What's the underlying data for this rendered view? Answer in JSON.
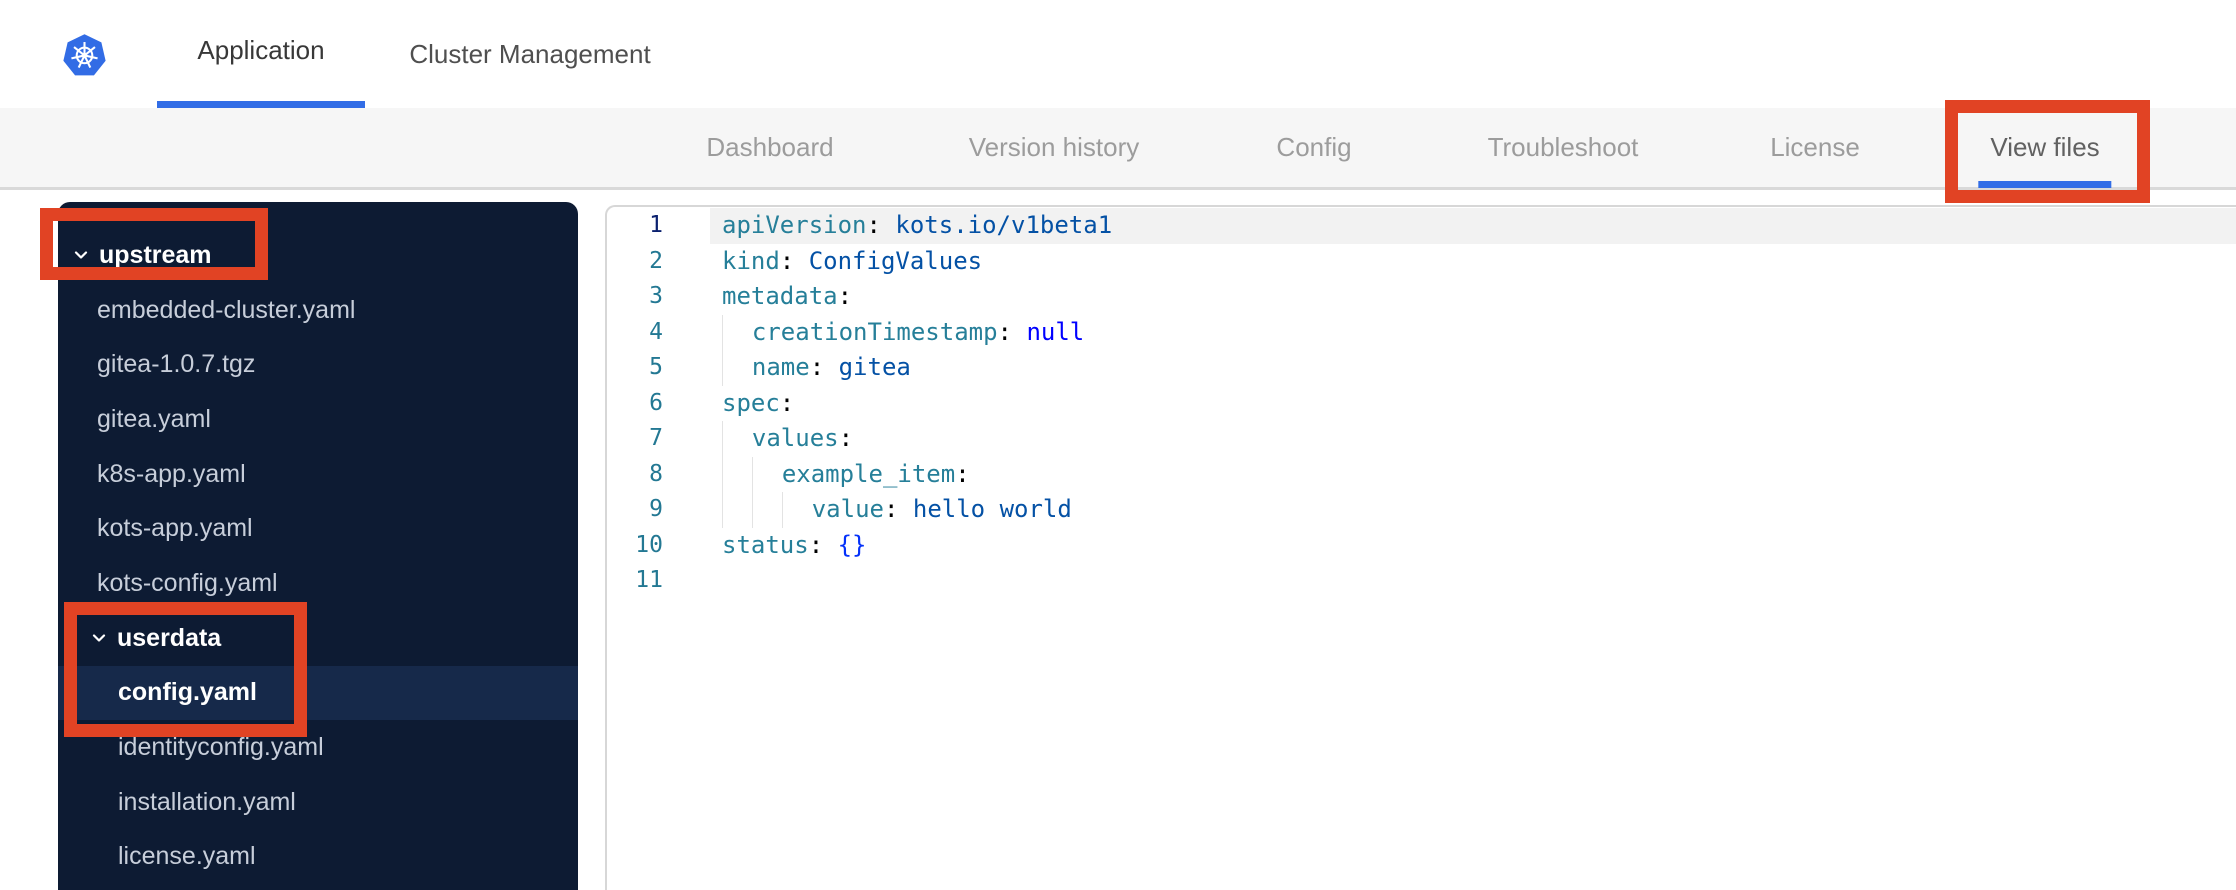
{
  "colors": {
    "accent": "#326DE6",
    "sidebar_bg": "#0D1B33",
    "selected_bg": "#16294A",
    "file_color": "#C7CEDA",
    "line_number": "#237893",
    "line_number_active": "#0B216F",
    "token_key": "#267F99",
    "token_string": "#0451A5",
    "token_keyword": "#0000FF",
    "token_bracket": "#0431FA",
    "annotation_red": "#E14324",
    "logo_blue": "#326CE5"
  },
  "header": {
    "tabs": [
      {
        "label": "Application",
        "active": true
      },
      {
        "label": "Cluster Management",
        "active": false
      }
    ]
  },
  "subnav": {
    "items": [
      {
        "label": "Dashboard",
        "active": false
      },
      {
        "label": "Version history",
        "active": false
      },
      {
        "label": "Config",
        "active": false
      },
      {
        "label": "Troubleshoot",
        "active": false
      },
      {
        "label": "License",
        "active": false
      },
      {
        "label": "View files",
        "active": true
      }
    ]
  },
  "file_tree": {
    "items": [
      {
        "type": "folder",
        "label": "upstream",
        "level": 0,
        "expanded": true,
        "selected": false
      },
      {
        "type": "file",
        "label": "embedded-cluster.yaml",
        "level": 1,
        "selected": false
      },
      {
        "type": "file",
        "label": "gitea-1.0.7.tgz",
        "level": 1,
        "selected": false
      },
      {
        "type": "file",
        "label": "gitea.yaml",
        "level": 1,
        "selected": false
      },
      {
        "type": "file",
        "label": "k8s-app.yaml",
        "level": 1,
        "selected": false
      },
      {
        "type": "file",
        "label": "kots-app.yaml",
        "level": 1,
        "selected": false
      },
      {
        "type": "file",
        "label": "kots-config.yaml",
        "level": 1,
        "selected": false
      },
      {
        "type": "folder",
        "label": "userdata",
        "level": 1,
        "expanded": true,
        "selected": false
      },
      {
        "type": "file",
        "label": "config.yaml",
        "level": 2,
        "selected": true
      },
      {
        "type": "file",
        "label": "identityconfig.yaml",
        "level": 2,
        "selected": false
      },
      {
        "type": "file",
        "label": "installation.yaml",
        "level": 2,
        "selected": false
      },
      {
        "type": "file",
        "label": "license.yaml",
        "level": 2,
        "selected": false
      }
    ]
  },
  "editor": {
    "lines": [
      {
        "num": 1,
        "indent": 0,
        "active": true,
        "tokens": [
          [
            "apiVersion",
            "key"
          ],
          [
            ":",
            "p"
          ],
          [
            " ",
            "p"
          ],
          [
            "kots.io/v1beta1",
            "str"
          ]
        ]
      },
      {
        "num": 2,
        "indent": 0,
        "active": false,
        "tokens": [
          [
            "kind",
            "key"
          ],
          [
            ":",
            "p"
          ],
          [
            " ",
            "p"
          ],
          [
            "ConfigValues",
            "str"
          ]
        ]
      },
      {
        "num": 3,
        "indent": 0,
        "active": false,
        "tokens": [
          [
            "metadata",
            "key"
          ],
          [
            ":",
            "p"
          ]
        ]
      },
      {
        "num": 4,
        "indent": 2,
        "active": false,
        "tokens": [
          [
            "creationTimestamp",
            "key"
          ],
          [
            ":",
            "p"
          ],
          [
            " ",
            "p"
          ],
          [
            "null",
            "kw"
          ]
        ]
      },
      {
        "num": 5,
        "indent": 2,
        "active": false,
        "tokens": [
          [
            "name",
            "key"
          ],
          [
            ":",
            "p"
          ],
          [
            " ",
            "p"
          ],
          [
            "gitea",
            "str"
          ]
        ]
      },
      {
        "num": 6,
        "indent": 0,
        "active": false,
        "tokens": [
          [
            "spec",
            "key"
          ],
          [
            ":",
            "p"
          ]
        ]
      },
      {
        "num": 7,
        "indent": 2,
        "active": false,
        "tokens": [
          [
            "values",
            "key"
          ],
          [
            ":",
            "p"
          ]
        ]
      },
      {
        "num": 8,
        "indent": 4,
        "active": false,
        "tokens": [
          [
            "example_item",
            "key"
          ],
          [
            ":",
            "p"
          ]
        ]
      },
      {
        "num": 9,
        "indent": 6,
        "active": false,
        "tokens": [
          [
            "value",
            "key"
          ],
          [
            ":",
            "p"
          ],
          [
            " ",
            "p"
          ],
          [
            "hello world",
            "str"
          ]
        ]
      },
      {
        "num": 10,
        "indent": 0,
        "active": false,
        "tokens": [
          [
            "status",
            "key"
          ],
          [
            ":",
            "p"
          ],
          [
            " ",
            "p"
          ],
          [
            "{}",
            "br"
          ]
        ]
      },
      {
        "num": 11,
        "indent": 0,
        "active": false,
        "tokens": []
      }
    ]
  },
  "annotations": [
    {
      "target": "upstream-folder"
    },
    {
      "target": "userdata-config-group"
    },
    {
      "target": "view-files-tab"
    }
  ]
}
